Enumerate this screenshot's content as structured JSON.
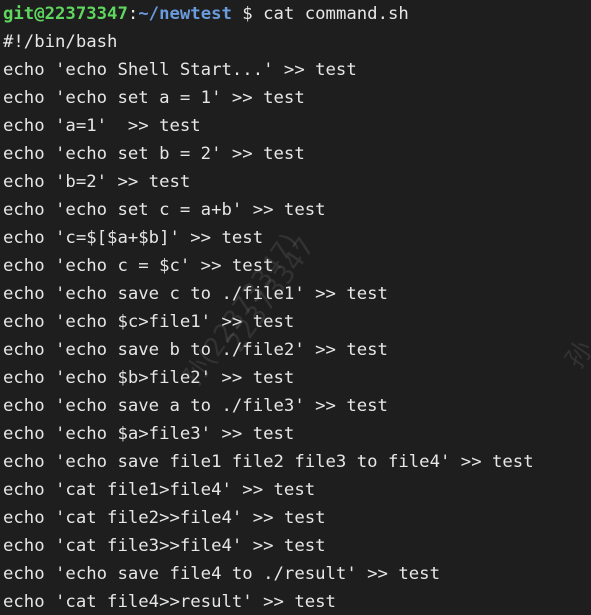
{
  "prompt": {
    "user_host": "git@22373347",
    "separator": ":",
    "cwd": "~/newtest",
    "symbol": " $ ",
    "command": "cat command.sh"
  },
  "output_lines": [
    "#!/bin/bash",
    "echo 'echo Shell Start...' >> test",
    "echo 'echo set a = 1' >> test",
    "echo 'a=1'  >> test",
    "echo 'echo set b = 2' >> test",
    "echo 'b=2' >> test",
    "echo 'echo set c = a+b' >> test",
    "echo 'c=$[$a+$b]' >> test",
    "echo 'echo c = $c' >> test",
    "echo 'echo save c to ./file1' >> test",
    "echo 'echo $c>file1' >> test",
    "echo 'echo save b to ./file2' >> test",
    "echo 'echo $b>file2' >> test",
    "echo 'echo save a to ./file3' >> test",
    "echo 'echo $a>file3' >> test",
    "echo 'echo save file1 file2 file3 to file4' >> test",
    "echo 'cat file1>file4' >> test",
    "echo 'cat file2>>file4' >> test",
    "echo 'cat file3>>file4' >> test",
    "echo 'echo save file4 to ./result' >> test",
    "echo 'cat file4>>result' >> test"
  ],
  "watermarks": {
    "main": "孙(22373347)",
    "secondary": "22373347",
    "edge": "孙"
  },
  "colors": {
    "background": "#1e1e1e",
    "text": "#e6e6e6",
    "user_host": "#5fd75f",
    "path": "#6a9bdc"
  }
}
